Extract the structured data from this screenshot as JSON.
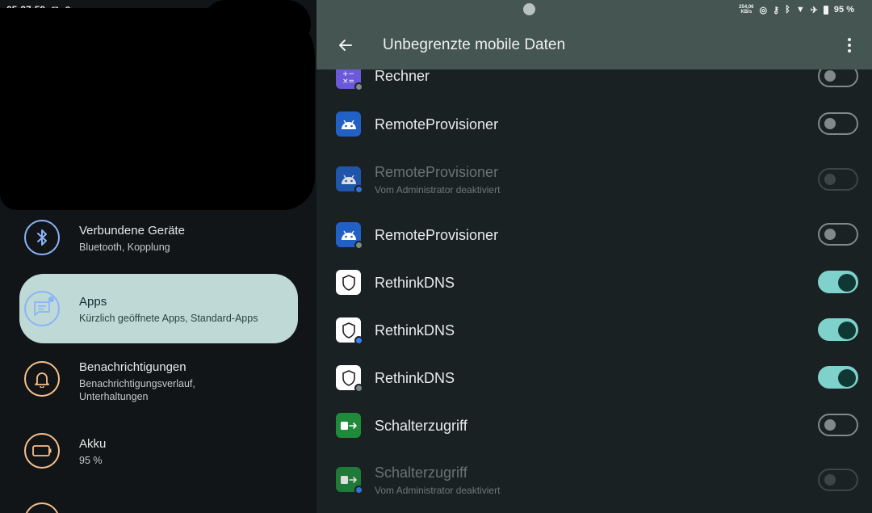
{
  "status_bar": {
    "time": "05:37:59",
    "network_speed_value": "254,06",
    "network_speed_unit": "KB/s",
    "battery": "95 %"
  },
  "left_panel": {
    "items": [
      {
        "title": "Verbundene Geräte",
        "subtitle": "Bluetooth, Kopplung",
        "icon": "bluetooth-icon",
        "color": "#8ab4f8"
      },
      {
        "title": "Apps",
        "subtitle": "Kürzlich geöffnete Apps, Standard-Apps",
        "icon": "apps-icon",
        "color": "#8ab4f8",
        "selected": true
      },
      {
        "title": "Benachrichtigungen",
        "subtitle": "Benachrichtigungsverlauf, Unterhaltungen",
        "icon": "bell-icon",
        "color": "#f6c08b"
      },
      {
        "title": "Akku",
        "subtitle": "95 %",
        "icon": "battery-icon",
        "color": "#f6c08b"
      }
    ]
  },
  "app_bar": {
    "title": "Unbegrenzte mobile Daten",
    "back_icon": "back-arrow-icon",
    "menu_icon": "more-vert-icon"
  },
  "apps": [
    {
      "name": "Rechner",
      "subtitle": "",
      "icon": "calculator-icon",
      "toggle": "off",
      "disabled": false
    },
    {
      "name": "RemoteProvisioner",
      "subtitle": "",
      "icon": "android-icon",
      "toggle": "off",
      "disabled": false
    },
    {
      "name": "RemoteProvisioner",
      "subtitle": "Vom Administrator deaktiviert",
      "icon": "android-icon",
      "toggle": "off",
      "disabled": true
    },
    {
      "name": "RemoteProvisioner",
      "subtitle": "",
      "icon": "android-icon",
      "toggle": "off",
      "disabled": false
    },
    {
      "name": "RethinkDNS",
      "subtitle": "",
      "icon": "rethinkdns-icon",
      "toggle": "on",
      "disabled": false
    },
    {
      "name": "RethinkDNS",
      "subtitle": "",
      "icon": "rethinkdns-icon",
      "toggle": "on",
      "disabled": false
    },
    {
      "name": "RethinkDNS",
      "subtitle": "",
      "icon": "rethinkdns-icon",
      "toggle": "on",
      "disabled": false
    },
    {
      "name": "Schalterzugriff",
      "subtitle": "",
      "icon": "switch-access-icon",
      "toggle": "off",
      "disabled": false
    },
    {
      "name": "Schalterzugriff",
      "subtitle": "Vom Administrator deaktiviert",
      "icon": "switch-access-icon",
      "toggle": "off",
      "disabled": true
    }
  ],
  "colors": {
    "toggle_on": "#7fd1cb",
    "selected_item_bg": "#bfd9d6",
    "app_bar_bg": "#445552"
  }
}
